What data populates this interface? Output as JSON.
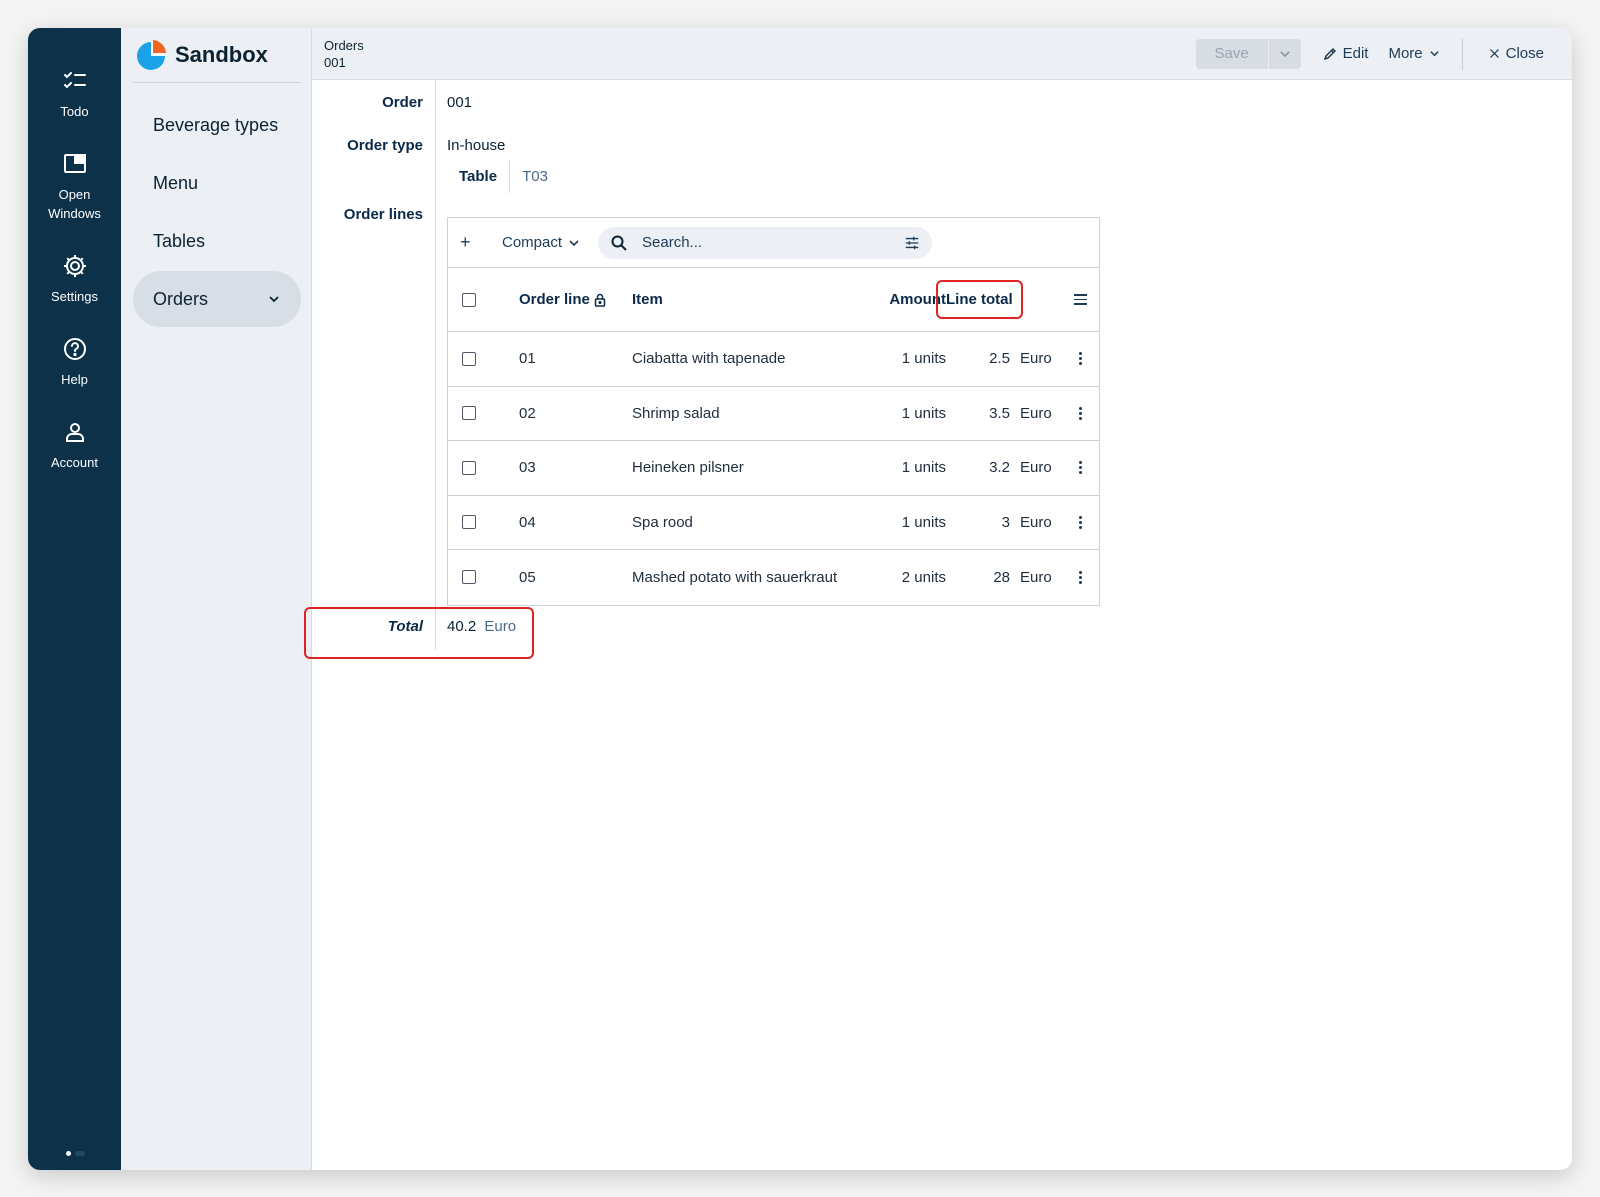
{
  "rail": {
    "items": [
      {
        "id": "todo",
        "label": "Todo",
        "icon": "checklist-icon"
      },
      {
        "id": "open-windows",
        "label": "Open\nWindows",
        "icon": "window-icon"
      },
      {
        "id": "settings",
        "label": "Settings",
        "icon": "gear-icon"
      },
      {
        "id": "help",
        "label": "Help",
        "icon": "help-circle-icon"
      },
      {
        "id": "account",
        "label": "Account",
        "icon": "user-icon"
      }
    ]
  },
  "brand": {
    "name": "Sandbox",
    "logo": "sandbox-logo-icon"
  },
  "nav": {
    "items": [
      {
        "label": "Beverage types"
      },
      {
        "label": "Menu"
      },
      {
        "label": "Tables"
      },
      {
        "label": "Orders",
        "active": true
      }
    ]
  },
  "topbar": {
    "breadcrumb": {
      "parent": "Orders",
      "current": "001"
    },
    "save_label": "Save",
    "edit_label": "Edit",
    "more_label": "More",
    "close_label": "Close"
  },
  "form": {
    "order_label": "Order",
    "order_value": "001",
    "order_type_label": "Order type",
    "order_type_value": "In-house",
    "table_label": "Table",
    "table_value": "T03",
    "order_lines_label": "Order lines",
    "total_label": "Total",
    "total_value": "40.2",
    "total_currency": "Euro"
  },
  "grid": {
    "add_label": "+",
    "view_label": "Compact",
    "search_placeholder": "Search...",
    "columns": {
      "line": "Order line",
      "item": "Item",
      "amount": "Amount",
      "line_total": "Line total"
    },
    "rows": [
      {
        "line": "01",
        "item": "Ciabatta with tapenade",
        "amount": "1 units",
        "total": "2.5",
        "currency": "Euro"
      },
      {
        "line": "02",
        "item": "Shrimp salad",
        "amount": "1 units",
        "total": "3.5",
        "currency": "Euro"
      },
      {
        "line": "03",
        "item": "Heineken pilsner",
        "amount": "1 units",
        "total": "3.2",
        "currency": "Euro"
      },
      {
        "line": "04",
        "item": "Spa rood",
        "amount": "1 units",
        "total": "3",
        "currency": "Euro"
      },
      {
        "line": "05",
        "item": "Mashed potato with sauerkraut",
        "amount": "2 units",
        "total": "28",
        "currency": "Euro"
      }
    ]
  },
  "colors": {
    "rail": "#0c3148",
    "nav": "#eceff3",
    "highlight": "#e02424",
    "accent": "#1d3b57"
  }
}
